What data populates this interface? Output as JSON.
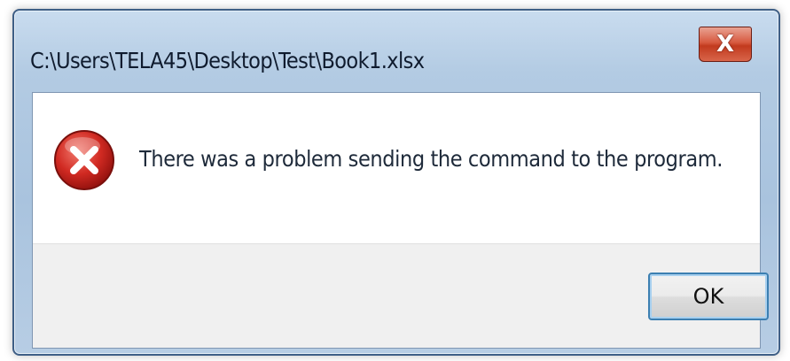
{
  "dialog": {
    "title": "C:\\Users\\TELA45\\Desktop\\Test\\Book1.xlsx",
    "message": "There was a problem sending the command to the program.",
    "close_label": "X",
    "ok_label": "OK",
    "icon": "error-icon"
  },
  "colors": {
    "frame": "#b3cbe3",
    "close_button": "#c23a1e",
    "ok_button_border": "#3c7fb1",
    "error_icon": "#c81e1e"
  }
}
